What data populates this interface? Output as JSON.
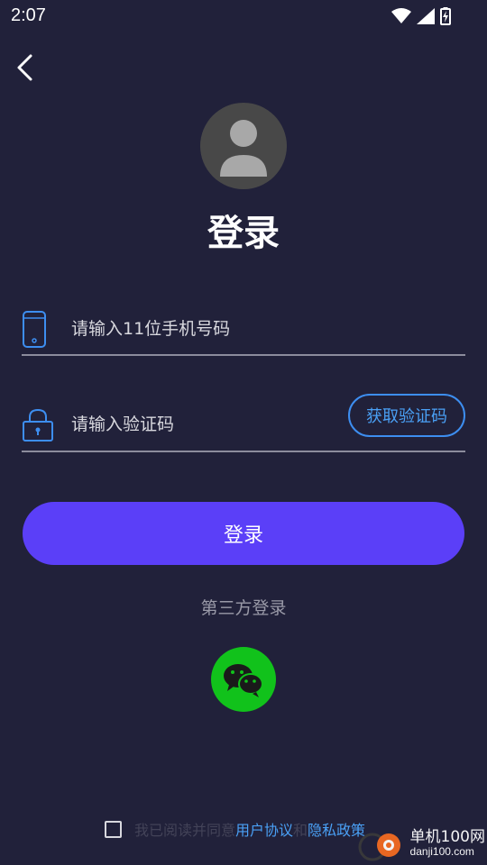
{
  "status_bar": {
    "time": "2:07",
    "icons": [
      "wifi-icon",
      "signal-icon",
      "battery-charging-icon"
    ]
  },
  "header": {
    "back_icon": "chevron-left-icon",
    "title": "登录"
  },
  "form": {
    "phone": {
      "icon": "phone-icon",
      "placeholder": "请输入11位手机号码",
      "value": ""
    },
    "code": {
      "icon": "lock-icon",
      "placeholder": "请输入验证码",
      "value": "",
      "get_code_label": "获取验证码"
    },
    "login_label": "登录"
  },
  "third_party": {
    "label": "第三方登录",
    "providers": [
      "wechat-icon"
    ]
  },
  "agreement": {
    "checked": false,
    "prefix": "我已阅读并同意",
    "user_agreement": "用户协议",
    "and": "和",
    "privacy_policy": "隐私政策"
  },
  "watermark": {
    "main": "单机100网",
    "sub": "danji100.com"
  },
  "colors": {
    "background": "#21213a",
    "primary_button": "#5b3ff8",
    "accent_blue": "#4aa0f5",
    "wechat_green": "#11c21b"
  }
}
